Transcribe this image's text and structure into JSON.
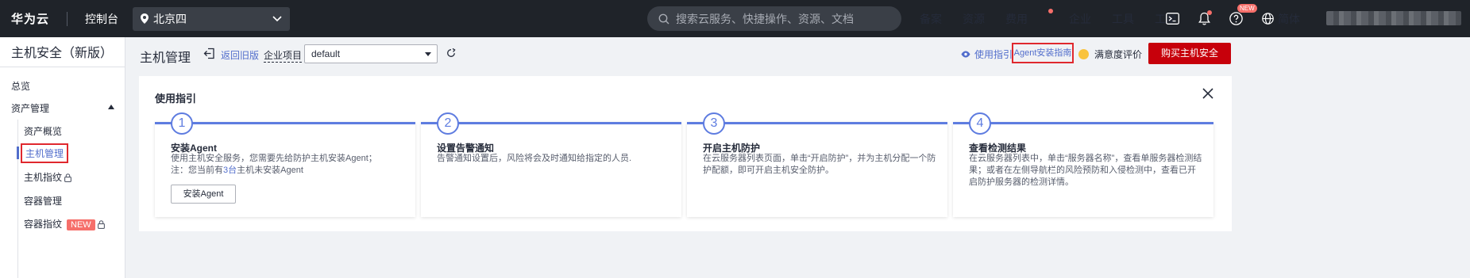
{
  "topbar": {
    "brand": "华为云",
    "console": "控制台",
    "region": "北京四",
    "search_placeholder": "搜索云服务、快捷操作、资源、文档",
    "nav": [
      "备案",
      "资源",
      "费用",
      "企业",
      "工具",
      "工单"
    ],
    "new_badge": "NEW",
    "language": "简体"
  },
  "sidebar": {
    "title": "主机安全（新版）",
    "overview": "总览",
    "asset_mgmt": "资产管理",
    "items": [
      {
        "label": "资产概览"
      },
      {
        "label": "主机管理"
      },
      {
        "label": "主机指纹"
      },
      {
        "label": "容器管理"
      },
      {
        "label": "容器指纹",
        "badge": "NEW"
      }
    ]
  },
  "header": {
    "title": "主机管理",
    "back_link": "返回旧版",
    "enterprise_project_label": "企业项目",
    "enterprise_project_value": "default",
    "usage_guide": "使用指引",
    "agent_guide": "Agent安装指南",
    "satisfaction": "满意度评价",
    "buy_button": "购买主机安全"
  },
  "guide": {
    "title": "使用指引",
    "steps": [
      {
        "num": "1",
        "title": "安装Agent",
        "desc1": "使用主机安全服务，您需要先给防护主机安装Agent；",
        "desc2_pre": "注：您当前有",
        "desc2_count": "3台",
        "desc2_post": "主机未安装Agent",
        "button": "安装Agent"
      },
      {
        "num": "2",
        "title": "设置告警通知",
        "desc": "告警通知设置后，风险将会及时通知给指定的人员."
      },
      {
        "num": "3",
        "title": "开启主机防护",
        "desc": "在云服务器列表页面，单击“开启防护”，并为主机分配一个防护配额，即可开启主机安全防护。"
      },
      {
        "num": "4",
        "title": "查看检测结果",
        "desc": "在云服务器列表中，单击“服务器名称”，查看单服务器检测结果；或者在左侧导航栏的风险预防和入侵检测中，查看已开启防护服务器的检测详情。"
      }
    ]
  },
  "colors": {
    "topbar_bg": "#1f2329",
    "accent": "#526ecc",
    "step_blue": "#5e7ce0",
    "buy_red": "#c7000b",
    "highlight_red": "#e0282e"
  }
}
